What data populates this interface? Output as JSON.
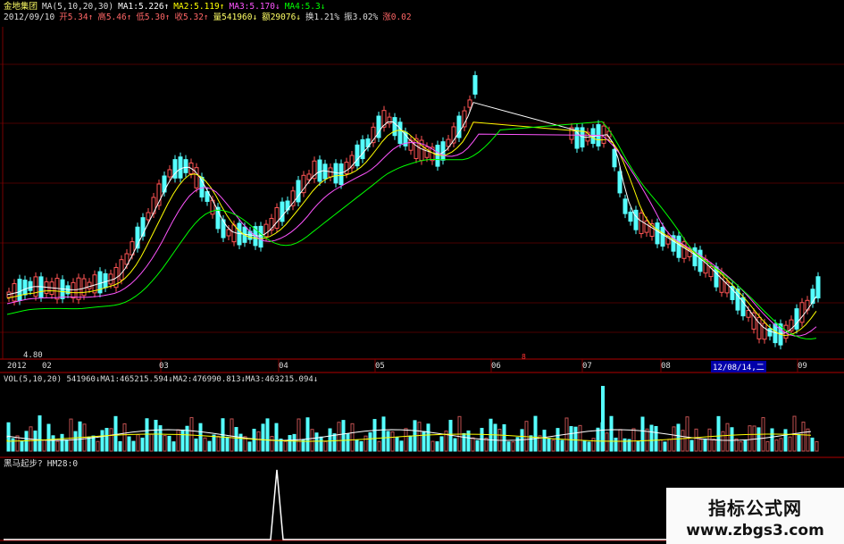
{
  "header1": {
    "stock_name": "金地集团",
    "ma_params": "MA(5,10,20,30)",
    "ma1": "MA1:5.226↑",
    "ma2": "MA2:5.119↑",
    "ma3": "MA3:5.170↓",
    "ma4": "MA4:5.3↓"
  },
  "header2": {
    "date": "2012/09/10",
    "open": "开5.34↑",
    "high": "高5.46↑",
    "low": "低5.30↑",
    "close": "收5.32↑",
    "volume": "量541960↓",
    "amount": "额29076↓",
    "turnover": "换1.21%",
    "amplitude": "振3.02%",
    "change": "涨0.02"
  },
  "price_panel": {
    "low_label": "4.80",
    "low_mark": "8",
    "time_axis": [
      "2012",
      "02",
      "03",
      "04",
      "05",
      "06",
      "07",
      "08",
      "12/08/14,二",
      "09"
    ]
  },
  "volume_panel": {
    "header": "VOL(5,10,20)  541960↓MA1:465215.594↓MA2:476990.813↓MA3:463215.094↓"
  },
  "indicator_panel": {
    "name": "黑马起步?",
    "value": "HM28:0"
  },
  "watermark": {
    "title": "指标公式网",
    "url": "www.zbgs3.com"
  },
  "colors": {
    "up": "#ff5555",
    "down": "#55ffff",
    "ma1": "#ffffff",
    "ma2": "#ffff00",
    "ma3": "#ff55ff",
    "ma4": "#00ff00",
    "grid": "#8b0000"
  }
}
